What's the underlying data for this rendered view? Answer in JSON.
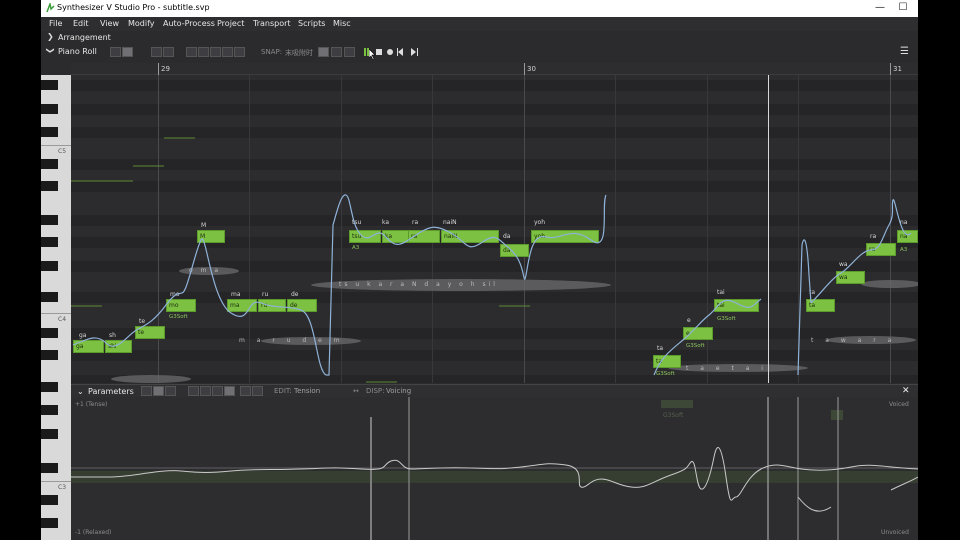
{
  "window": {
    "title": "Synthesizer V Studio Pro - subtitle.svp",
    "minimize": "—",
    "maximize": "☐"
  },
  "menu": [
    "File",
    "Edit",
    "View",
    "Modify",
    "Auto-Process",
    "Project",
    "Transport",
    "Scripts",
    "Misc"
  ],
  "arrangement": {
    "label": "Arrangement"
  },
  "piano_roll": {
    "label": "Piano Roll",
    "snap_label": "SNAP:",
    "snap_value": "末吸附时",
    "menu_icon": "☰"
  },
  "ruler": {
    "bars": [
      "29",
      "30",
      "31"
    ]
  },
  "piano": {
    "octave_labels": [
      "C5",
      "C4",
      "C3"
    ]
  },
  "notes": [
    {
      "lyric": "ga",
      "text": "ga",
      "sub": ""
    },
    {
      "lyric": "sh",
      "text": "shi",
      "sub": ""
    },
    {
      "lyric": "te",
      "text": "te",
      "sub": ""
    },
    {
      "lyric": "mo",
      "text": "mo",
      "sub": "G3Soft"
    },
    {
      "lyric": "M",
      "text": "M",
      "sub": ""
    },
    {
      "lyric": "ma",
      "text": "ma",
      "sub": ""
    },
    {
      "lyric": "ru",
      "text": "ru",
      "sub": ""
    },
    {
      "lyric": "de",
      "text": "de",
      "sub": ""
    },
    {
      "lyric": "tsu",
      "text": "tsu",
      "sub": "A3"
    },
    {
      "lyric": "ka",
      "text": "ka",
      "sub": ""
    },
    {
      "lyric": "ra",
      "text": "ra",
      "sub": ""
    },
    {
      "lyric": "naiN",
      "text": "naiN",
      "sub": ""
    },
    {
      "lyric": "da",
      "text": "da",
      "sub": ""
    },
    {
      "lyric": "yoh",
      "text": "yoh",
      "sub": ""
    },
    {
      "lyric": "ta",
      "text": "ta",
      "sub": "G3Soft"
    },
    {
      "lyric": "e",
      "text": "e",
      "sub": "G3Soft"
    },
    {
      "lyric": "tai",
      "text": "tai",
      "sub": "G3Soft"
    },
    {
      "lyric": "ta",
      "text": "ta",
      "sub": ""
    },
    {
      "lyric": "wa",
      "text": "wa",
      "sub": ""
    },
    {
      "lyric": "ra",
      "text": "ra",
      "sub": "A3"
    },
    {
      "lyric": "na",
      "text": "na",
      "sub": ""
    }
  ],
  "phonemes": {
    "row1": "o m a",
    "row2": "ts u k a r a N d a y o h sil",
    "row3": "m a r u d e m",
    "row4": "t a w a r a",
    "row5": "t a e t a i"
  },
  "parameters": {
    "label": "Parameters",
    "edit_label": "EDIT:",
    "edit_value": "Tension",
    "disp_label": "DISP:",
    "disp_value": "Voicing",
    "top_label": "+1 (Tense)",
    "bottom_label": "-1 (Relaxed)",
    "right_top": "Voiced",
    "right_bottom": "Unvoiced",
    "close": "✕",
    "ghost_sub": "G3Soft"
  },
  "colors": {
    "note_fill": "#7cc141",
    "pitch_curve": "#8fb2d8",
    "background": "#2c2c2e"
  }
}
